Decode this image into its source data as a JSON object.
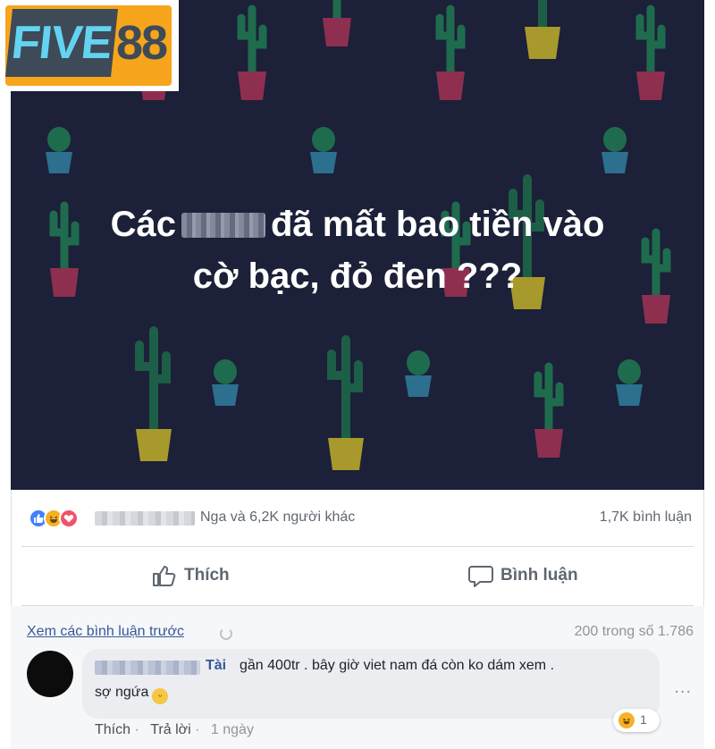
{
  "logo": {
    "word": "FIVE",
    "number": "88"
  },
  "post": {
    "text_prefix": "Các",
    "text_suffix": "đã mất bao tiền vào",
    "text_line2": "cờ bạc, đỏ đen ???"
  },
  "reactions": {
    "icons": [
      "like-icon",
      "haha-icon",
      "love-icon"
    ],
    "summary": "Nga và 6,2K người khác",
    "comment_count": "1,7K bình luận"
  },
  "actions": {
    "like_label": "Thích",
    "comment_label": "Bình luận"
  },
  "comments": {
    "view_previous": "Xem các bình luận trước",
    "count_of": "200 trong số 1.786",
    "items": [
      {
        "name": "Tài",
        "text_line1": "gần 400tr . bây giờ viet nam đá còn ko dám xem .",
        "text_line2": "sợ ngứa",
        "like_action": "Thích",
        "reply_action": "Trả lời",
        "time": "1 ngày",
        "reaction_count": "1",
        "more": "..."
      }
    ]
  },
  "colors": {
    "post_bg": "#1c2038",
    "link": "#365899",
    "logo_orange": "#f6a51c",
    "logo_dark": "#3e4a57",
    "logo_cyan": "#63d3f1"
  }
}
